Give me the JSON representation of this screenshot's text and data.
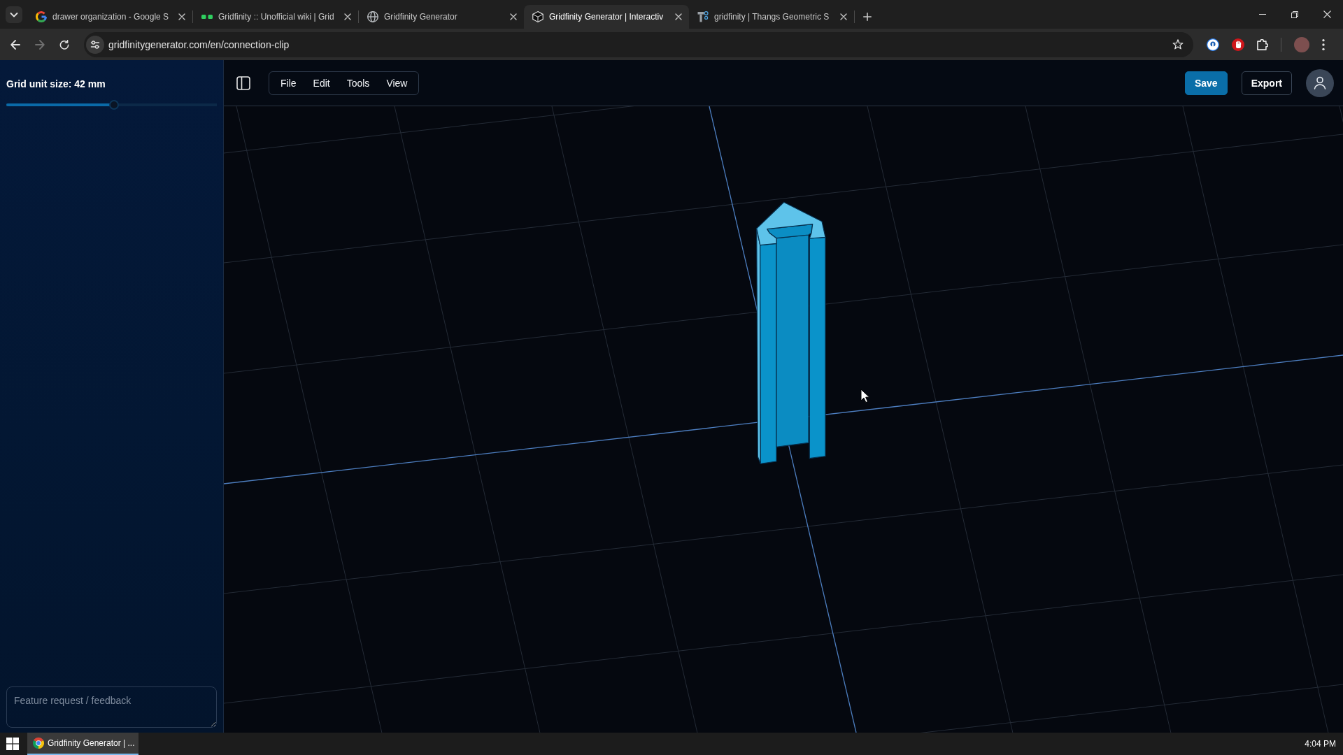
{
  "browser": {
    "tabs": [
      {
        "title": "drawer organization - Google S",
        "selected": false
      },
      {
        "title": "Gridfinity :: Unofficial wiki | Grid",
        "selected": false
      },
      {
        "title": "Gridfinity Generator",
        "selected": false
      },
      {
        "title": "Gridfinity Generator | Interactiv",
        "selected": true
      },
      {
        "title": "gridfinity | Thangs Geometric S",
        "selected": false
      }
    ],
    "address": "gridfinitygenerator.com/en/connection-clip",
    "forward_disabled": true
  },
  "sidebar": {
    "grid_unit_label": "Grid unit size: 42 mm",
    "grid_unit_slider": {
      "level": 0.51
    },
    "feedback": {
      "placeholder": "Feature request / feedback"
    }
  },
  "toolbar": {
    "menus": [
      "File",
      "Edit",
      "Tools",
      "View"
    ],
    "buttons": [
      {
        "label": "Save",
        "kind": "primary"
      },
      {
        "label": "Export",
        "kind": "outline"
      }
    ]
  },
  "taskbar": {
    "tasks": [
      {
        "label": "Gridfinity Generator | ...",
        "selected": true
      }
    ],
    "clock": "4:04 PM"
  }
}
